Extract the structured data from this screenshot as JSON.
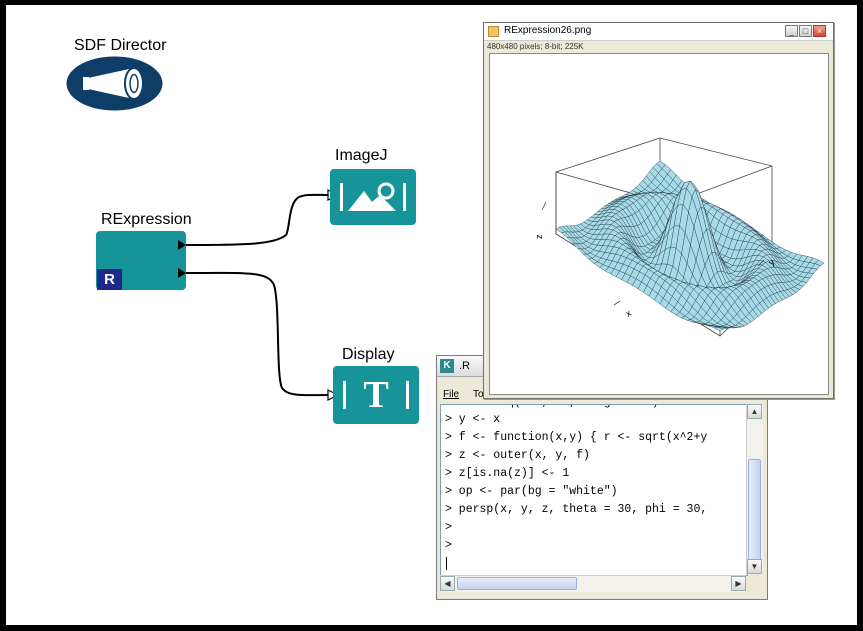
{
  "director": {
    "label": "SDF Director"
  },
  "actors": {
    "rexpression": {
      "label": "RExpression",
      "badge": "R"
    },
    "imagej": {
      "label": "ImageJ"
    },
    "display": {
      "label": "Display",
      "glyph": "T"
    }
  },
  "image_window": {
    "title": "RExpression26.png",
    "subtitle": "480x480 pixels; 8-bit; 225K",
    "buttons": [
      "_",
      "□",
      "×"
    ],
    "axis_labels": {
      "x": "x",
      "y": "y",
      "z": "z"
    }
  },
  "console": {
    "icon": "K",
    "title": ".R",
    "menu": [
      "File",
      "To"
    ],
    "lines": [
      "> y <- x",
      "> f <- function(x,y) { r <- sqrt(x^2+y",
      "> z <- outer(x, y, f)",
      "> z[is.na(z)] <- 1",
      "> op <- par(bg = \"white\")",
      "> persp(x, y, z, theta = 30, phi = 30,",
      ">",
      ">",
      ""
    ]
  },
  "colors": {
    "actor": "#17949a",
    "director": "#0e3e68",
    "badge": "#1d2a8c",
    "surface": "#a8dbe8"
  }
}
